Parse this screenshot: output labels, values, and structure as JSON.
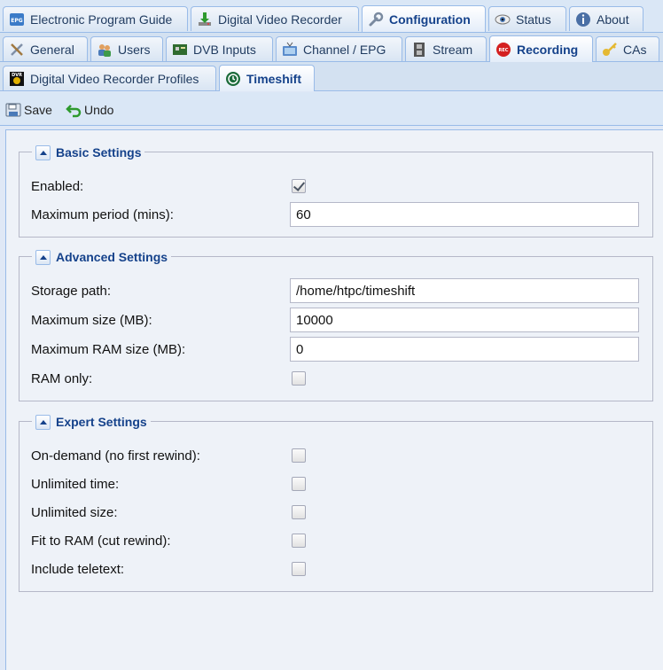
{
  "tabs_l1": [
    {
      "label": "Electronic Program Guide",
      "icon": "epg-icon"
    },
    {
      "label": "Digital Video Recorder",
      "icon": "download-icon"
    },
    {
      "label": "Configuration",
      "icon": "wrench-icon",
      "active": true
    },
    {
      "label": "Status",
      "icon": "eye-icon"
    },
    {
      "label": "About",
      "icon": "info-icon"
    }
  ],
  "tabs_l2": [
    {
      "label": "General",
      "icon": "tools-icon"
    },
    {
      "label": "Users",
      "icon": "users-icon"
    },
    {
      "label": "DVB Inputs",
      "icon": "card-icon"
    },
    {
      "label": "Channel / EPG",
      "icon": "tv-icon"
    },
    {
      "label": "Stream",
      "icon": "film-icon"
    },
    {
      "label": "Recording",
      "icon": "rec-icon",
      "active": true
    },
    {
      "label": "CAs",
      "icon": "key-icon"
    }
  ],
  "tabs_l3": [
    {
      "label": "Digital Video Recorder Profiles",
      "icon": "dvr-icon"
    },
    {
      "label": "Timeshift",
      "icon": "timeshift-icon",
      "active": true
    }
  ],
  "toolbar": {
    "save": "Save",
    "undo": "Undo"
  },
  "basic": {
    "title": "Basic Settings",
    "enabled_label": "Enabled:",
    "enabled": true,
    "max_period_label": "Maximum period (mins):",
    "max_period": "60"
  },
  "advanced": {
    "title": "Advanced Settings",
    "storage_path_label": "Storage path:",
    "storage_path": "/home/htpc/timeshift",
    "max_size_label": "Maximum size (MB):",
    "max_size": "10000",
    "max_ram_label": "Maximum RAM size (MB):",
    "max_ram": "0",
    "ram_only_label": "RAM only:",
    "ram_only": false
  },
  "expert": {
    "title": "Expert Settings",
    "on_demand_label": "On-demand (no first rewind):",
    "unlimited_time_label": "Unlimited time:",
    "unlimited_size_label": "Unlimited size:",
    "fit_ram_label": "Fit to RAM (cut rewind):",
    "teletext_label": "Include teletext:"
  },
  "colors": {
    "accent": "#15428b",
    "tab_border": "#99bbe8",
    "panel_bg": "#eef2f8"
  }
}
